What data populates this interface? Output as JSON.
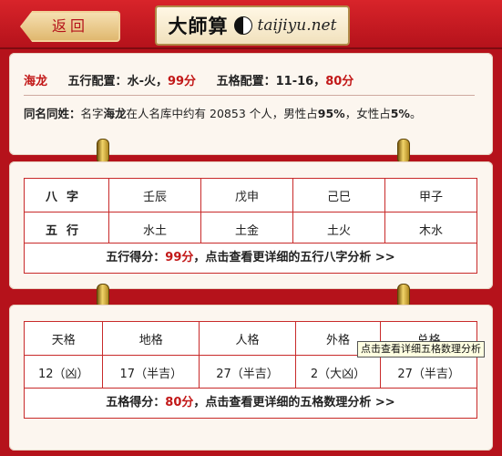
{
  "header": {
    "back_label": "返回",
    "logo_text": "大師算",
    "logo_url": "taijiyu.net"
  },
  "summary": {
    "name": "海龙",
    "wuxing_label": "五行配置：",
    "wuxing_value": "水-火，",
    "wuxing_score": "99分",
    "wuge_label": "五格配置：",
    "wuge_value": "11-16，",
    "wuge_score": "80分",
    "same_name_label": "同名同姓：",
    "same_name_pre": "名字",
    "same_name_name": "海龙",
    "same_name_post": "在人名库中约有  20853 个人，男性占",
    "male_pct": "95%",
    "female_pre": "，女性占",
    "female_pct": "5%",
    "end": "。"
  },
  "bazi": {
    "row1_header": "八字",
    "row1": [
      "壬辰",
      "戊申",
      "己巳",
      "甲子"
    ],
    "row2_header": "五行",
    "row2": [
      "水土",
      "土金",
      "土火",
      "木水"
    ],
    "link_pre": "五行得分：",
    "link_score": "99分",
    "link_post": "，点击查看更详细的五行八字分析 >>"
  },
  "wuge": {
    "headers": [
      "天格",
      "地格",
      "人格",
      "外格",
      "总格"
    ],
    "values": [
      "12（凶）",
      "17（半吉）",
      "27（半吉）",
      "2（大凶）",
      "27（半吉）"
    ],
    "link_pre": "五格得分：",
    "link_score": "80分",
    "link_post": "，点击查看更详细的五格数理分析 >>"
  },
  "tooltip": "点击查看详细五格数理分析"
}
